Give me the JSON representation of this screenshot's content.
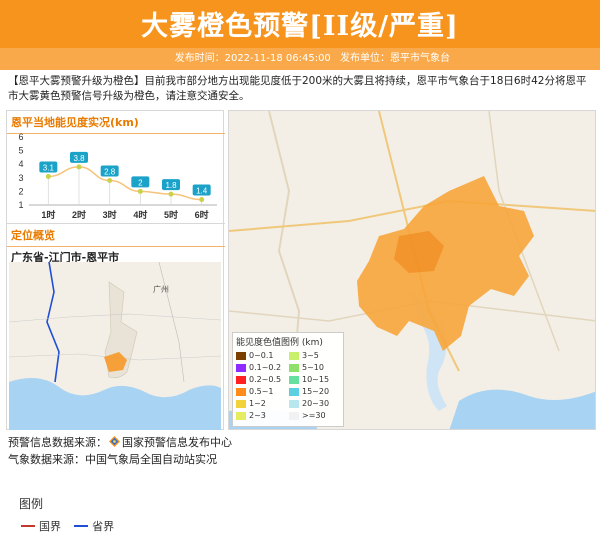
{
  "header": {
    "title": "大雾橙色预警[II级/严重]",
    "publish_time_label": "发布时间：2022-11-18 06:45:00",
    "publisher_label": "发布单位：恩平市气象台",
    "background_color": "#f7941d"
  },
  "notice": "【恩平大雾预警升级为橙色】目前我市部分地方出现能见度低于200米的大雾且将持续，恩平市气象台于18日6时42分将恩平市大雾黄色预警信号升级为橙色，请注意交通安全。",
  "visibility_section": {
    "title": "恩平当地能见度实况(km)"
  },
  "chart_data": {
    "type": "line",
    "title": "恩平当地能见度实况(km)",
    "categories": [
      "1时",
      "2时",
      "3时",
      "4时",
      "5时",
      "6时"
    ],
    "series": [
      {
        "values": [
          3.1,
          3.8,
          2.8,
          2,
          1.8,
          1.4
        ]
      }
    ],
    "y_ticks": [
      1,
      2,
      3,
      4,
      5,
      6
    ],
    "ylim": [
      1,
      6
    ],
    "grid": false,
    "colors": {
      "line": "#f7c37a",
      "point": "#c9d24a",
      "label_bg": "#1aa2c8"
    }
  },
  "location": {
    "title": "定位概览",
    "name": "广东省-江门市-恩平市",
    "map_label": "广州"
  },
  "legend": {
    "title": "图例",
    "items": [
      {
        "label": "国界",
        "color": "#c0392b"
      },
      {
        "label": "省界",
        "color": "#1f4fd6"
      }
    ]
  },
  "visibility_legend": {
    "title": "能见度色值图例 (km)",
    "items": [
      {
        "label": "0~0.1",
        "color": "#7b3f00"
      },
      {
        "label": "3~5",
        "color": "#c8f06a"
      },
      {
        "label": "0.1~0.2",
        "color": "#8e2cff"
      },
      {
        "label": "5~10",
        "color": "#8fe06a"
      },
      {
        "label": "0.2~0.5",
        "color": "#ff2020"
      },
      {
        "label": "10~15",
        "color": "#66e0a0"
      },
      {
        "label": "0.5~1",
        "color": "#ff8c1a"
      },
      {
        "label": "15~20",
        "color": "#5ad0e0"
      },
      {
        "label": "1~2",
        "color": "#f2d23a"
      },
      {
        "label": "20~30",
        "color": "#b8e6ef"
      },
      {
        "label": "2~3",
        "color": "#e6ec60"
      },
      {
        "label": ">=30",
        "color": "#f2f2f2"
      }
    ]
  },
  "footer": {
    "warning_source": "预警信息数据来源：",
    "warning_source_name": "国家预警信息发布中心",
    "weather_source": "气象数据来源：中国气象局全国自动站实况"
  }
}
